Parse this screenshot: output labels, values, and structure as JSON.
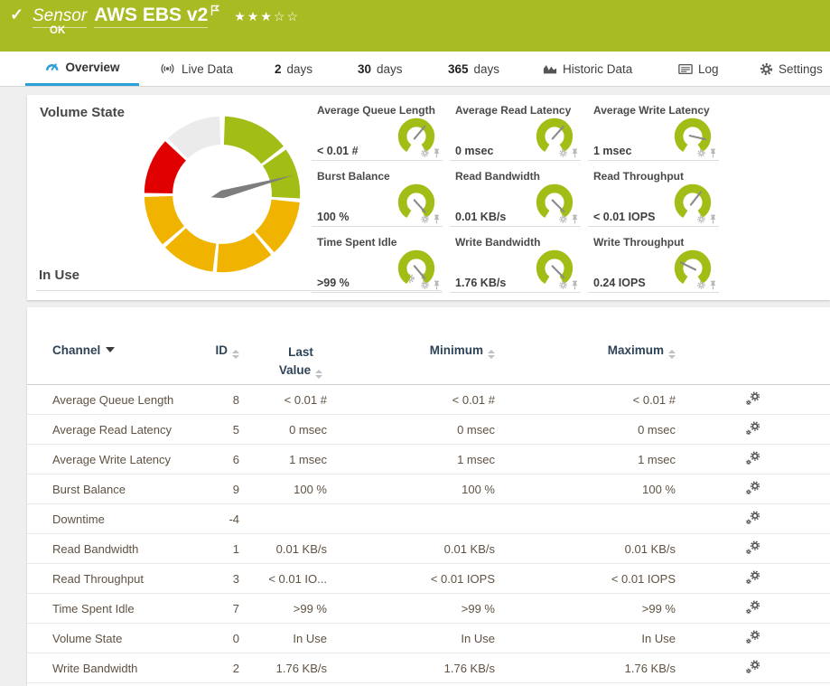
{
  "header": {
    "kind_label": "Sensor",
    "sensor_name": "AWS EBS v2",
    "status": "OK",
    "priority_stars": {
      "filled": 3,
      "total": 5
    }
  },
  "tabs": [
    {
      "label": "Overview",
      "active": true
    },
    {
      "label": "Live Data"
    },
    {
      "num": "2",
      "label": "days"
    },
    {
      "num": "30",
      "label": "days"
    },
    {
      "num": "365",
      "label": "days"
    },
    {
      "label": "Historic Data"
    },
    {
      "label": "Log"
    },
    {
      "label": "Settings"
    }
  ],
  "colors": {
    "ok_green": "#a8bb22",
    "accent_blue": "#2b9fd8",
    "gauge_green": "#a3bd17",
    "gauge_yellow": "#f0b400",
    "gauge_red": "#e10000",
    "gauge_gray": "#ebebeb",
    "needle_gray": "#7d7d7d"
  },
  "primary_gauge": {
    "title": "Volume State",
    "value": "In Use",
    "needle_deg": 75,
    "segments": [
      {
        "from": 2,
        "to": 52,
        "color": "#a3bd17"
      },
      {
        "from": 55,
        "to": 93,
        "color": "#a3bd17"
      },
      {
        "from": 96,
        "to": 138,
        "color": "#f0b400"
      },
      {
        "from": 141,
        "to": 184,
        "color": "#f0b400"
      },
      {
        "from": 187,
        "to": 227,
        "color": "#f0b400"
      },
      {
        "from": 230,
        "to": 268,
        "color": "#f0b400"
      },
      {
        "from": 271,
        "to": 313,
        "color": "#e10000"
      },
      {
        "from": 316,
        "to": 358,
        "color": "#ebebeb"
      }
    ]
  },
  "small_gauges": [
    {
      "title": "Average Queue Length",
      "value": "< 0.01 #",
      "needle_deg": 40
    },
    {
      "title": "Average Read Latency",
      "value": "0 msec",
      "needle_deg": 42
    },
    {
      "title": "Average Write Latency",
      "value": "1 msec",
      "needle_deg": 103
    },
    {
      "title": "Burst Balance",
      "value": "100 %",
      "needle_deg": 138
    },
    {
      "title": "Read Bandwidth",
      "value": "0.01 KB/s",
      "needle_deg": 135
    },
    {
      "title": "Read Throughput",
      "value": "< 0.01 IOPS",
      "needle_deg": 38
    },
    {
      "title": "Time Spent Idle",
      "value": ">99 %",
      "needle_deg": 140
    },
    {
      "title": "Write Bandwidth",
      "value": "1.76 KB/s",
      "needle_deg": 135
    },
    {
      "title": "Write Throughput",
      "value": "0.24 IOPS",
      "needle_deg": 296
    }
  ],
  "table": {
    "columns": [
      "Channel",
      "ID",
      "Last Value",
      "Minimum",
      "Maximum"
    ],
    "rows": [
      {
        "channel": "Average Queue Length",
        "id": "8",
        "last": "< 0.01 #",
        "min": "< 0.01 #",
        "max": "< 0.01 #"
      },
      {
        "channel": "Average Read Latency",
        "id": "5",
        "last": "0 msec",
        "min": "0 msec",
        "max": "0 msec"
      },
      {
        "channel": "Average Write Latency",
        "id": "6",
        "last": "1 msec",
        "min": "1 msec",
        "max": "1 msec"
      },
      {
        "channel": "Burst Balance",
        "id": "9",
        "last": "100 %",
        "min": "100 %",
        "max": "100 %"
      },
      {
        "channel": "Downtime",
        "id": "-4",
        "last": "",
        "min": "",
        "max": ""
      },
      {
        "channel": "Read Bandwidth",
        "id": "1",
        "last": "0.01 KB/s",
        "min": "0.01 KB/s",
        "max": "0.01 KB/s"
      },
      {
        "channel": "Read Throughput",
        "id": "3",
        "last": "< 0.01 IO...",
        "min": "< 0.01 IOPS",
        "max": "< 0.01 IOPS"
      },
      {
        "channel": "Time Spent Idle",
        "id": "7",
        "last": ">99 %",
        "min": ">99 %",
        "max": ">99 %"
      },
      {
        "channel": "Volume State",
        "id": "0",
        "last": "In Use",
        "min": "In Use",
        "max": "In Use"
      },
      {
        "channel": "Write Bandwidth",
        "id": "2",
        "last": "1.76 KB/s",
        "min": "1.76 KB/s",
        "max": "1.76 KB/s"
      }
    ]
  }
}
